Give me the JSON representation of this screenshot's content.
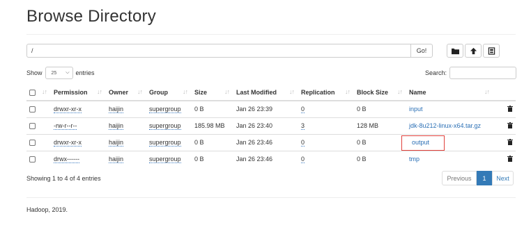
{
  "page": {
    "title": "Browse Directory",
    "path_value": "/",
    "go_label": "Go!",
    "footer": "Hadoop, 2019."
  },
  "toolbar": {
    "icons": [
      "folder-icon",
      "upload-icon",
      "cut-icon"
    ]
  },
  "length": {
    "show_label": "Show",
    "value": "25",
    "entries_label": "entries"
  },
  "search": {
    "label": "Search:",
    "value": ""
  },
  "table": {
    "columns": [
      "Permission",
      "Owner",
      "Group",
      "Size",
      "Last Modified",
      "Replication",
      "Block Size",
      "Name"
    ],
    "rows": [
      {
        "permission": "drwxr-xr-x",
        "owner": "haijin",
        "group": "supergroup",
        "size": "0 B",
        "modified": "Jan 26 23:39",
        "replication": "0",
        "block_size": "0 B",
        "name": "input"
      },
      {
        "permission": "-rw-r--r--",
        "owner": "haijin",
        "group": "supergroup",
        "size": "185.98 MB",
        "modified": "Jan 26 23:40",
        "replication": "3",
        "block_size": "128 MB",
        "name": "jdk-8u212-linux-x64.tar.gz"
      },
      {
        "permission": "drwxr-xr-x",
        "owner": "haijin",
        "group": "supergroup",
        "size": "0 B",
        "modified": "Jan 26 23:46",
        "replication": "0",
        "block_size": "0 B",
        "name": "output"
      },
      {
        "permission": "drwx------",
        "owner": "haijin",
        "group": "supergroup",
        "size": "0 B",
        "modified": "Jan 26 23:46",
        "replication": "0",
        "block_size": "0 B",
        "name": "tmp"
      }
    ]
  },
  "pagination": {
    "info": "Showing 1 to 4 of 4 entries",
    "previous": "Previous",
    "current": "1",
    "next": "Next"
  },
  "colors": {
    "link": "#2a6fb5",
    "active_page": "#337ab7",
    "highlight_box": "#e0403a"
  }
}
